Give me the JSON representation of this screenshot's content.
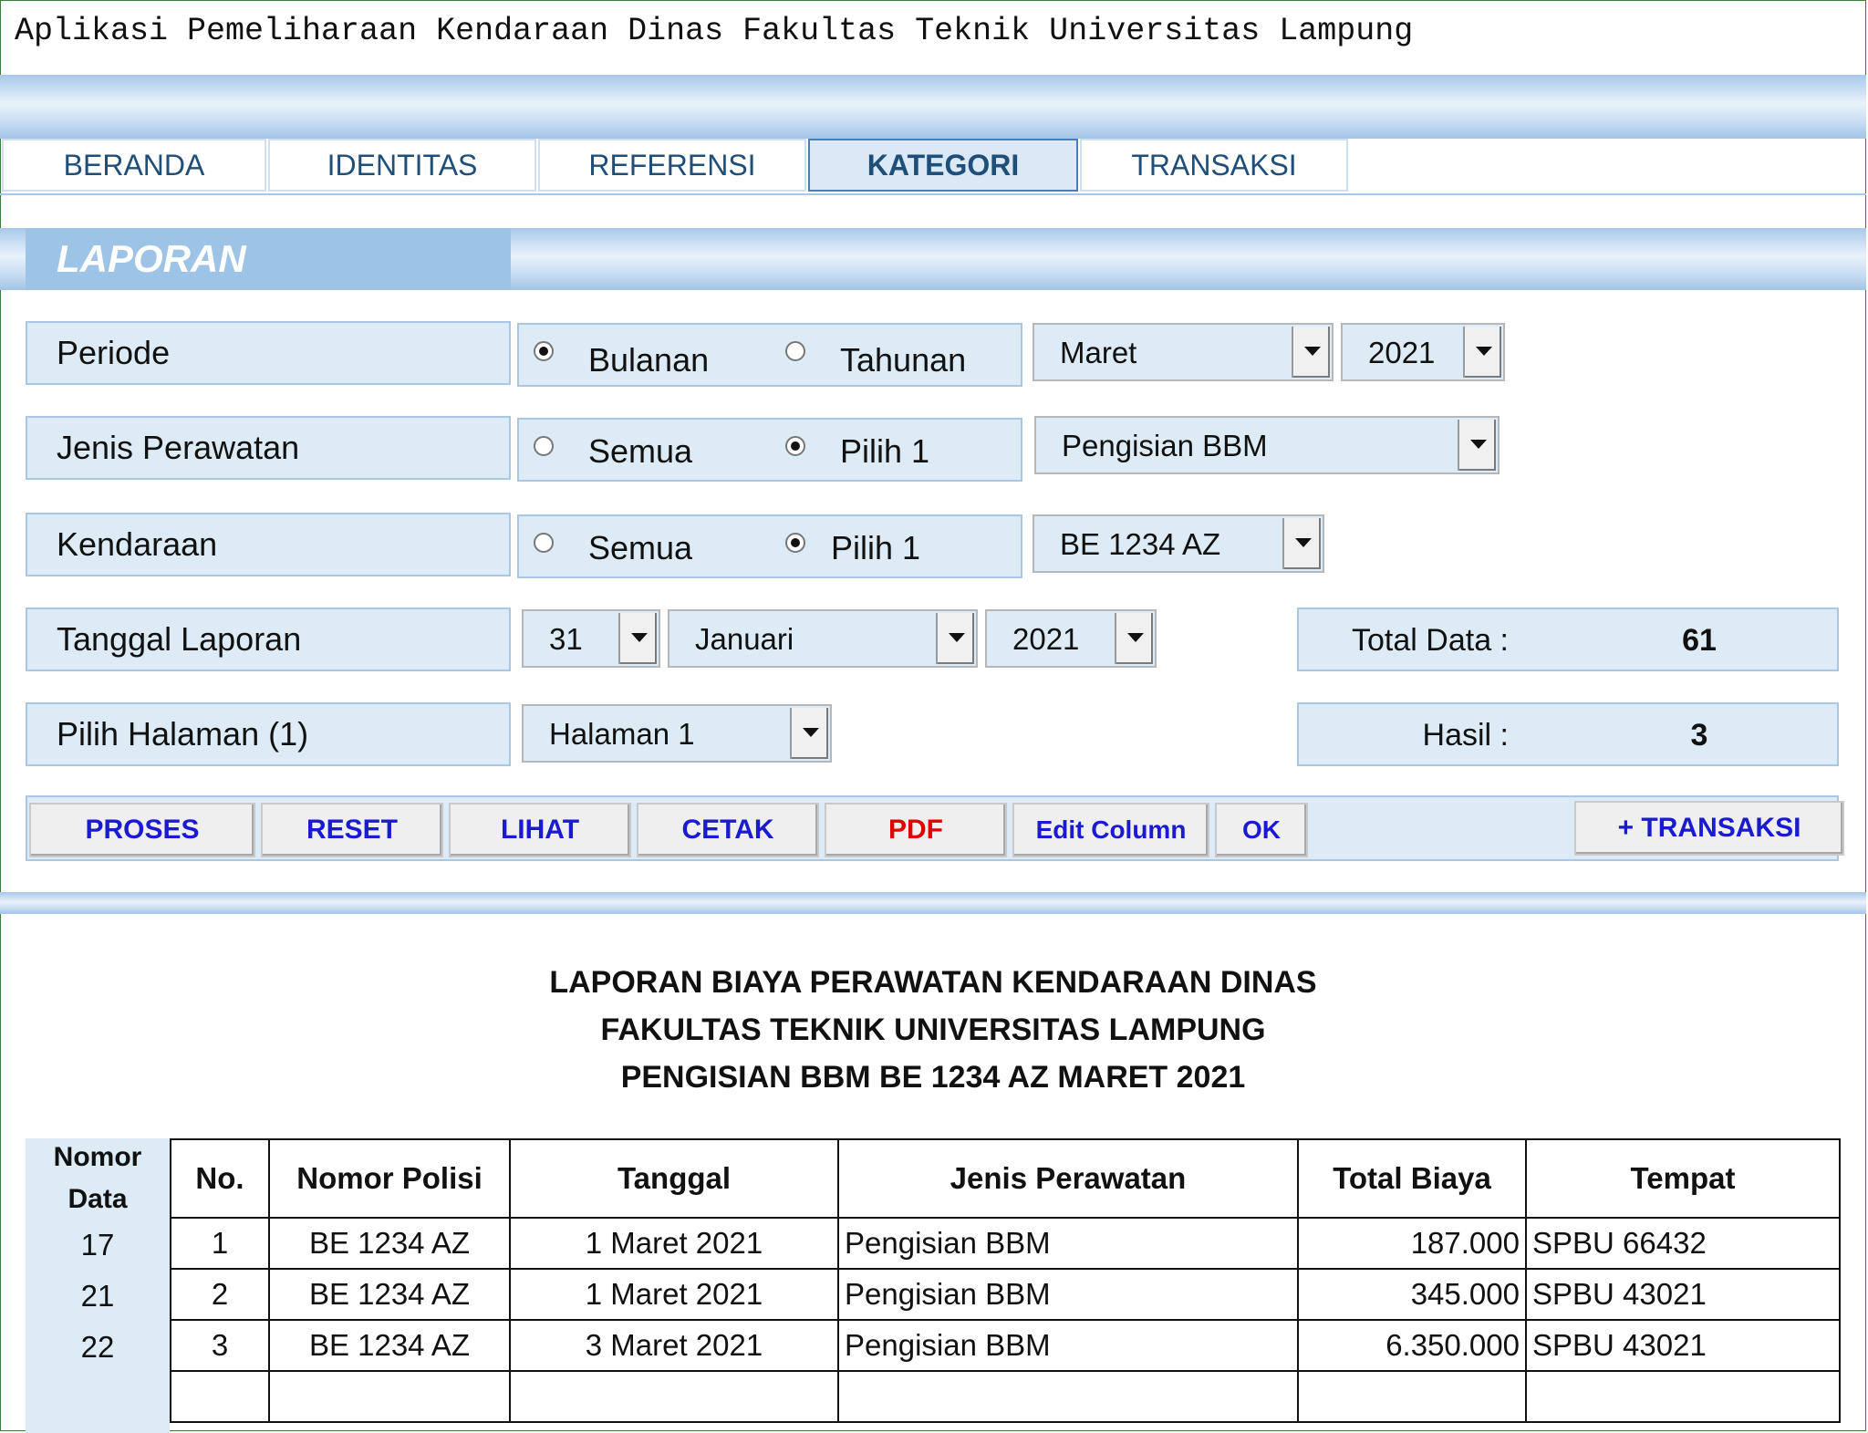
{
  "app_title": "Aplikasi Pemeliharaan Kendaraan Dinas Fakultas Teknik Universitas Lampung",
  "tabs": [
    {
      "label": "BERANDA"
    },
    {
      "label": "IDENTITAS"
    },
    {
      "label": "REFERENSI"
    },
    {
      "label": "KATEGORI",
      "active": true
    },
    {
      "label": "TRANSAKSI"
    }
  ],
  "section_title": "LAPORAN",
  "form": {
    "periode": {
      "label": "Periode",
      "opt1": "Bulanan",
      "opt2": "Tahunan",
      "selected": "Bulanan",
      "bulan": "Maret",
      "tahun": "2021"
    },
    "jenis": {
      "label": "Jenis Perawatan",
      "opt1": "Semua",
      "opt2": "Pilih 1",
      "selected": "Pilih 1",
      "value": "Pengisian BBM"
    },
    "kendaraan": {
      "label": "Kendaraan",
      "opt1": "Semua",
      "opt2": "Pilih 1",
      "selected": "Pilih 1",
      "value": "BE 1234 AZ"
    },
    "tanggal": {
      "label": "Tanggal Laporan",
      "hari": "31",
      "bulan": "Januari",
      "tahun": "2021"
    },
    "halaman": {
      "label": "Pilih Halaman (1)",
      "value": "Halaman 1"
    }
  },
  "stats": {
    "total_label": "Total Data :",
    "total_value": "61",
    "hasil_label": "Hasil :",
    "hasil_value": "3"
  },
  "buttons": {
    "proses": "PROSES",
    "reset": "RESET",
    "lihat": "LIHAT",
    "cetak": "CETAK",
    "pdf": "PDF",
    "edit_column": "Edit Column",
    "ok": "OK",
    "transaksi": "+ TRANSAKSI"
  },
  "colors": {
    "accent_blue": "#1a1ad0",
    "pdf_red": "#e00000",
    "tab_text": "#1f4e79",
    "panel_fill": "#ddebf7"
  },
  "report": {
    "title_lines": [
      "LAPORAN BIAYA PERAWATAN KENDARAAN DINAS",
      "FAKULTAS TEKNIK UNIVERSITAS LAMPUNG",
      "PENGISIAN BBM BE 1234 AZ MARET 2021"
    ],
    "nomor_data_header": [
      "Nomor",
      "Data"
    ],
    "columns": [
      "No.",
      "Nomor Polisi",
      "Tanggal",
      "Jenis Perawatan",
      "Total Biaya",
      "Tempat"
    ],
    "rows": [
      {
        "nomor_data": "17",
        "no": "1",
        "polisi": "BE 1234 AZ",
        "tanggal": "1 Maret 2021",
        "jenis": "Pengisian BBM",
        "biaya": "187.000",
        "tempat": "SPBU 66432"
      },
      {
        "nomor_data": "21",
        "no": "2",
        "polisi": "BE 1234 AZ",
        "tanggal": "1 Maret 2021",
        "jenis": "Pengisian BBM",
        "biaya": "345.000",
        "tempat": "SPBU 43021"
      },
      {
        "nomor_data": "22",
        "no": "3",
        "polisi": "BE 1234 AZ",
        "tanggal": "3 Maret 2021",
        "jenis": "Pengisian BBM",
        "biaya": "6.350.000",
        "tempat": "SPBU 43021"
      }
    ]
  }
}
